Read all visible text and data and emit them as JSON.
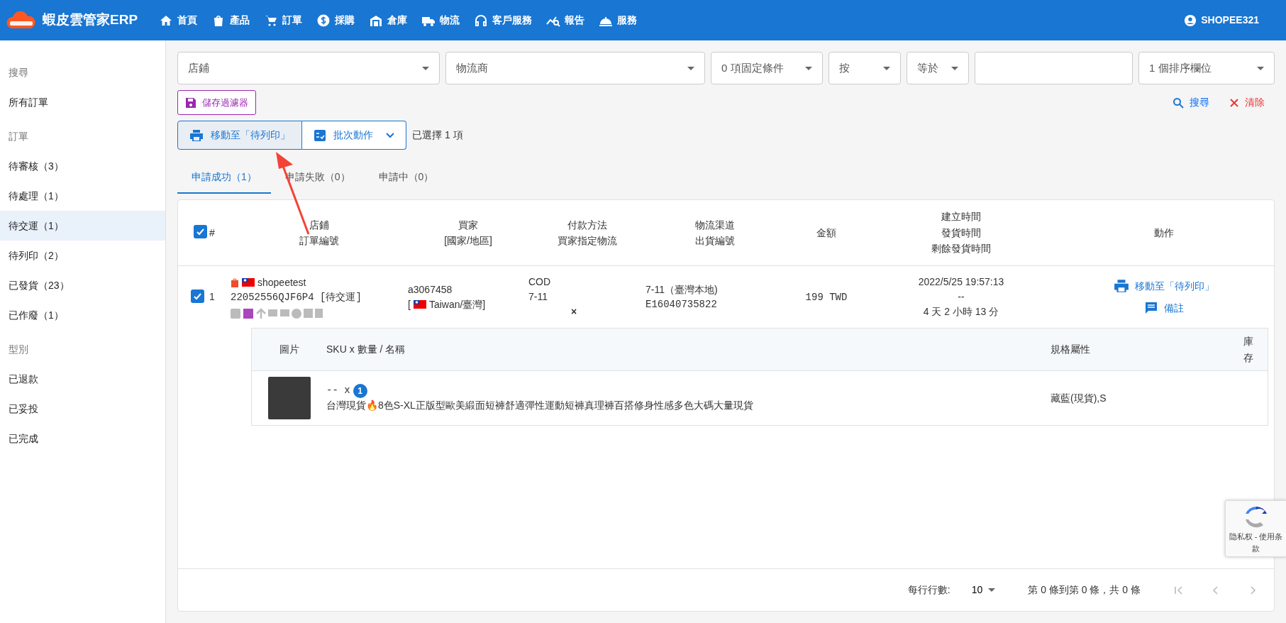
{
  "navbar": {
    "brand": "蝦皮雲管家ERP",
    "items": [
      {
        "label": "首頁"
      },
      {
        "label": "產品"
      },
      {
        "label": "訂單"
      },
      {
        "label": "採購"
      },
      {
        "label": "倉庫"
      },
      {
        "label": "物流"
      },
      {
        "label": "客戶服務"
      },
      {
        "label": "報告"
      },
      {
        "label": "服務"
      }
    ],
    "user": "SHOPEE321"
  },
  "sidebar": {
    "items": [
      {
        "kind": "heading",
        "label": "搜尋"
      },
      {
        "kind": "link",
        "label": "所有訂單",
        "selected": false
      },
      {
        "kind": "heading",
        "label": "訂單"
      },
      {
        "kind": "link",
        "label": "待審核（3）",
        "selected": false
      },
      {
        "kind": "link",
        "label": "待處理（1）",
        "selected": false
      },
      {
        "kind": "link",
        "label": "待交運（1）",
        "selected": true
      },
      {
        "kind": "link",
        "label": "待列印（2）",
        "selected": false
      },
      {
        "kind": "link",
        "label": "已發貨（23）",
        "selected": false
      },
      {
        "kind": "link",
        "label": "已作廢（1）",
        "selected": false
      },
      {
        "kind": "heading",
        "label": "型別"
      },
      {
        "kind": "link",
        "label": "已退款",
        "selected": false
      },
      {
        "kind": "link",
        "label": "已妥投",
        "selected": false
      },
      {
        "kind": "link",
        "label": "已完成",
        "selected": false
      }
    ]
  },
  "filters": [
    {
      "kind": "select",
      "label": "店鋪"
    },
    {
      "kind": "select",
      "label": "物流商"
    },
    {
      "kind": "select",
      "label": "0 項固定條件"
    },
    {
      "kind": "select",
      "label": "按"
    },
    {
      "kind": "select",
      "label": "等於"
    },
    {
      "kind": "input"
    },
    {
      "kind": "select",
      "label": "1 個排序欄位"
    }
  ],
  "save_filter_button": "儲存過濾器",
  "search_link": "搜尋",
  "clear_link": "清除",
  "actions": {
    "move_button": "移動至「待列印」",
    "batch_button": "批次動作",
    "selected_text": "已選擇 1 項"
  },
  "tabs": [
    {
      "label": "申請成功（1）",
      "selected": true
    },
    {
      "label": "申請失敗（0）",
      "selected": false
    },
    {
      "label": "申請中（0）",
      "selected": false
    }
  ],
  "table": {
    "all_checked": true,
    "columns": [
      {
        "lines": [
          "#"
        ]
      },
      {
        "lines": [
          "店鋪",
          "訂單編號"
        ]
      },
      {
        "lines": [
          "買家",
          "[國家/地區]"
        ]
      },
      {
        "lines": [
          "付款方法",
          "買家指定物流"
        ]
      },
      {
        "lines": [
          "物流渠道",
          "出貨編號"
        ]
      },
      {
        "lines": [
          "金額"
        ]
      },
      {
        "lines": [
          "建立時間",
          "發貨時間",
          "剩餘發貨時間"
        ]
      },
      {
        "lines": [
          "動作"
        ]
      }
    ],
    "rows": [
      {
        "checked": true,
        "index": "1",
        "shop": "shopeetest",
        "order_no": "22052556QJF6P4 [待交運]",
        "buyer": "a3067458",
        "country_open": "[",
        "country": "Taiwan/臺灣]",
        "payment": "COD",
        "logistics": "7-11",
        "mark": "×",
        "channel": "7-11（臺灣本地)",
        "tracking": "E16040735822",
        "amount": "199 TWD",
        "created": "2022/5/25 19:57:13",
        "shipped": "--",
        "remaining": "4 天 2 小時 13 分",
        "actions": [
          "移動至「待列印」",
          "備註"
        ],
        "items_table": {
          "columns": [
            "圖片",
            "SKU x 數量 / 名稱",
            "規格屬性",
            "庫存"
          ],
          "items": [
            {
              "sku": "-- x",
              "qty": "1",
              "name": "台灣現貨🔥8色S-XL正版型歐美緞面短褲舒適彈性運動短褲真理褲百搭修身性感多色大碼大量現貨",
              "spec": "藏藍(現貨),S"
            }
          ]
        }
      }
    ]
  },
  "pagination": {
    "rows_label": "每行行數:",
    "rows_value": "10",
    "range": "第 0 條到第 0 條，共 0 條"
  },
  "recaptcha": "隐私权 - 使用条款"
}
